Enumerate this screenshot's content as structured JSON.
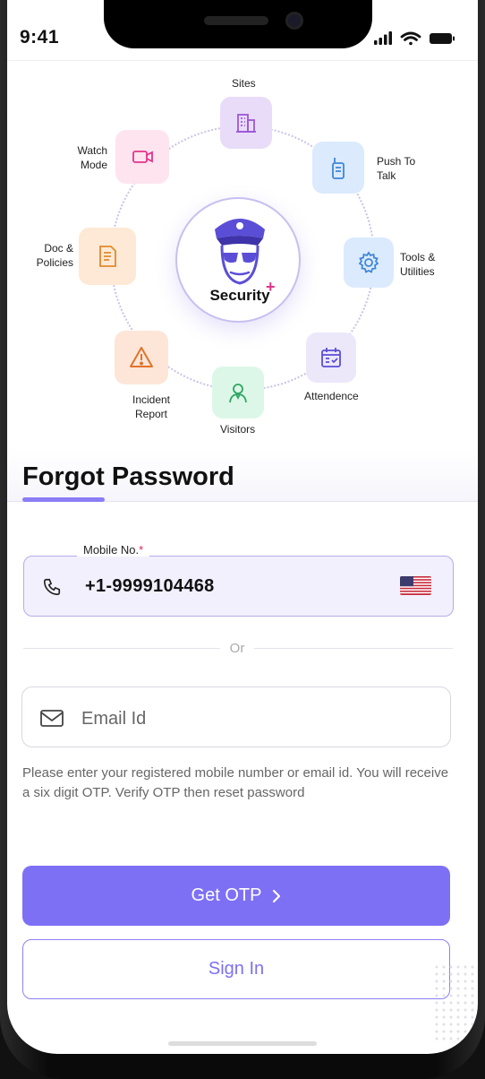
{
  "status_bar": {
    "time": "9:41"
  },
  "modules": {
    "center_label": "Security",
    "center_plus": "+",
    "items": [
      {
        "label": "Sites",
        "icon": "building-icon"
      },
      {
        "label": "Push To Talk",
        "icon": "walkie-talkie-icon"
      },
      {
        "label": "Tools & Utilities",
        "icon": "gear-icon"
      },
      {
        "label": "Attendence",
        "icon": "calendar-icon"
      },
      {
        "label": "Visitors",
        "icon": "visitor-icon"
      },
      {
        "label": "Incident Report",
        "icon": "warning-icon"
      },
      {
        "label": "Doc & Policies",
        "icon": "document-icon"
      },
      {
        "label": "Watch Mode",
        "icon": "video-camera-icon"
      }
    ]
  },
  "form": {
    "title": "Forgot Password",
    "mobile": {
      "label": "Mobile No.",
      "required_mark": "*",
      "value": "+1-9999104468",
      "country_flag": "us-flag-icon"
    },
    "divider_text": "Or",
    "email": {
      "placeholder": "Email Id",
      "value": ""
    },
    "help_text": "Please enter your registered mobile number or email id. You will receive a six digit OTP. Verify OTP then reset password",
    "get_otp_label": "Get OTP",
    "sign_in_label": "Sign In"
  },
  "colors": {
    "accent": "#7d70f5",
    "accent_light": "#f2f0fd",
    "required": "#e0245e",
    "plus": "#e3338a"
  }
}
